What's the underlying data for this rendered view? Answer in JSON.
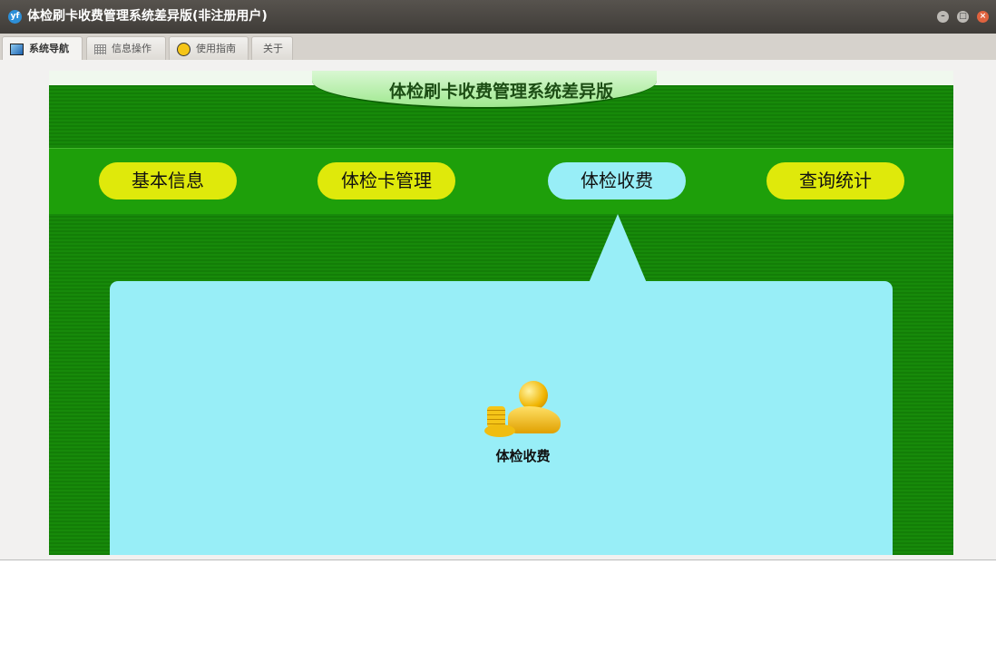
{
  "window": {
    "title": "体检刷卡收费管理系统差异版(非注册用户)",
    "logo": "yf"
  },
  "tabs": [
    {
      "label": "系统导航",
      "icon": "monitor-icon"
    },
    {
      "label": "信息操作",
      "icon": "grid-icon"
    },
    {
      "label": "使用指南",
      "icon": "help-icon"
    },
    {
      "label": "关于"
    }
  ],
  "banner": {
    "title": "体检刷卡收费管理系统差异版"
  },
  "nav": [
    "基本信息",
    "体检卡管理",
    "体检收费",
    "查询统计"
  ],
  "active_nav": "体检收费",
  "items": [
    {
      "label": "体检收费",
      "icon": "gold-coins-icon"
    }
  ]
}
